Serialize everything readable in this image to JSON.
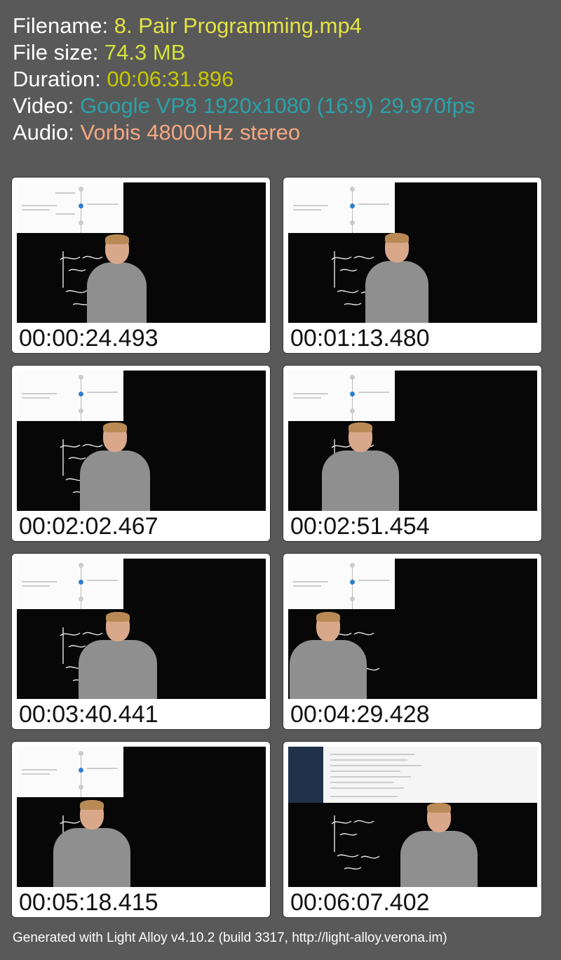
{
  "info": {
    "filename_label": "Filename: ",
    "filename": "8. Pair Programming.mp4",
    "filesize_label": "File size: ",
    "filesize": "74.3 MB",
    "duration_label": "Duration: ",
    "duration": "00:06:31.896",
    "video_label": "Video: ",
    "video": "Google VP8 1920x1080 (16:9) 29.970fps",
    "audio_label": "Audio: ",
    "audio": "Vorbis 48000Hz stereo"
  },
  "colors": {
    "filename": "#e4e444",
    "filesize": "#d2e23c",
    "duration": "#c8c800",
    "video": "#2aa3a8",
    "audio": "#f4a882"
  },
  "thumbnails": [
    {
      "time": "00:00:24.493"
    },
    {
      "time": "00:01:13.480"
    },
    {
      "time": "00:02:02.467"
    },
    {
      "time": "00:02:51.454"
    },
    {
      "time": "00:03:40.441"
    },
    {
      "time": "00:04:29.428"
    },
    {
      "time": "00:05:18.415"
    },
    {
      "time": "00:06:07.402"
    }
  ],
  "footer": "Generated with Light Alloy v4.10.2 (build 3317, http://light-alloy.verona.im)"
}
